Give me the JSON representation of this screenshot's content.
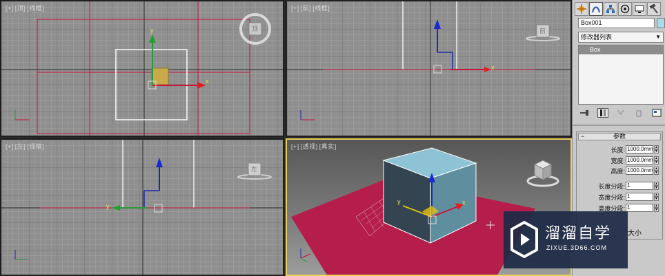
{
  "viewports": {
    "top": {
      "plus": "[+]",
      "view": "[顶]",
      "shading": "[线框]",
      "cube_label": "顶"
    },
    "front": {
      "plus": "[+]",
      "view": "[前]",
      "shading": "[线框]",
      "cube_label": "前"
    },
    "left": {
      "plus": "[+]",
      "view": "[左]",
      "shading": "[线框]",
      "cube_label": "左"
    },
    "perspective": {
      "plus": "[+]",
      "view": "[透视]",
      "shading": "[真实]"
    }
  },
  "axes": {
    "x": "x",
    "y": "y",
    "z": "z"
  },
  "command_panel": {
    "tabs": [
      "create-tab",
      "modify-tab",
      "hierarchy-tab",
      "motion-tab",
      "display-tab",
      "utilities-tab"
    ],
    "object_name": "Box001",
    "object_color": "#a9dcea",
    "modifier_list": "修改器列表",
    "stack_item": "Box",
    "rollout_title": "参数",
    "params": {
      "length_label": "长度:",
      "length_value": "1000.0mm",
      "width_label": "宽度:",
      "width_value": "1000.0mm",
      "height_label": "高度:",
      "height_value": "1000.0mm",
      "length_segs_label": "长度分段:",
      "length_segs_value": "1",
      "width_segs_label": "宽度分段:",
      "width_segs_value": "1",
      "height_segs_label": "高度分段:",
      "height_segs_value": "1"
    }
  },
  "watermark": {
    "title": "溜溜自学",
    "url": "ZIXUE.3D66.COM",
    "side_text": "大小"
  },
  "colors": {
    "selection_red": "#c8143c",
    "viewport_active": "#e8d25c",
    "box_teal": "#5f8f9e",
    "ground": "#b51e4a"
  }
}
